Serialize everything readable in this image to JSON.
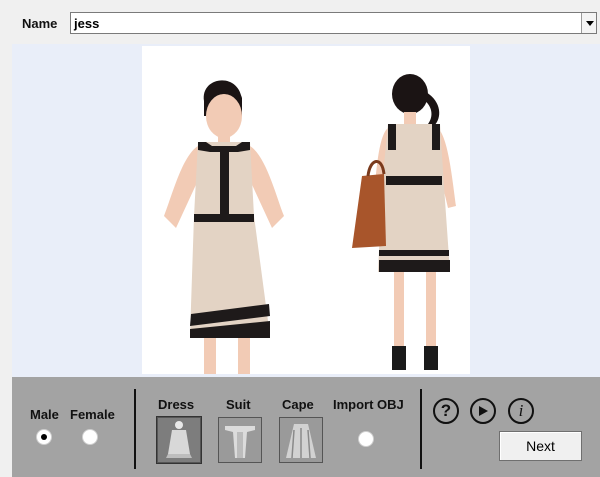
{
  "name_field": {
    "label": "Name",
    "value": "jess"
  },
  "gender": {
    "male_label": "Male",
    "female_label": "Female",
    "selected": "Male"
  },
  "garment_types": {
    "dress_label": "Dress",
    "suit_label": "Suit",
    "cape_label": "Cape",
    "import_label": "Import OBJ"
  },
  "icons": {
    "help": "question-mark-icon",
    "play": "play-icon",
    "info": "info-icon"
  },
  "next_button": {
    "label": "Next"
  },
  "colors": {
    "preview_bg": "#e9eef9",
    "panel_bg": "#a3a3a3",
    "dress": "#e3d3c4",
    "trim": "#1e1a1a"
  }
}
